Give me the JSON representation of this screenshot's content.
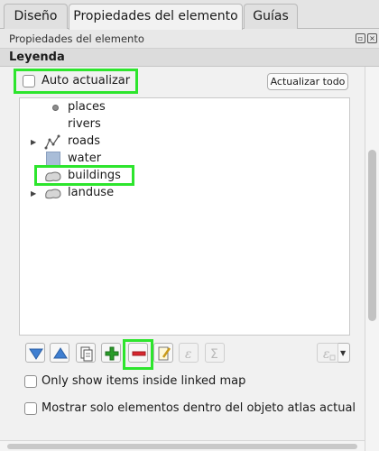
{
  "tabs": [
    {
      "label": "Diseño",
      "active": false
    },
    {
      "label": "Propiedades del elemento",
      "active": true
    },
    {
      "label": "Guías",
      "active": false
    }
  ],
  "panel": {
    "title": "Propiedades del elemento"
  },
  "section": {
    "title": "Leyenda"
  },
  "auto_update": {
    "label": "Auto actualizar",
    "checked": false
  },
  "refresh_all_label": "Actualizar todo",
  "tree": [
    {
      "label": "places",
      "symbol": "point-icon",
      "expandable": false
    },
    {
      "label": "rivers",
      "symbol": "none",
      "expandable": false
    },
    {
      "label": "roads",
      "symbol": "line-icon",
      "expandable": true
    },
    {
      "label": "water",
      "symbol": "polygon-fill-icon",
      "color": "#a9bdd8",
      "expandable": false
    },
    {
      "label": "buildings",
      "symbol": "polygon-outline-icon",
      "expandable": false
    },
    {
      "label": "landuse",
      "symbol": "polygon-outline-icon",
      "expandable": true
    }
  ],
  "toolbar": [
    {
      "name": "move-down-icon",
      "enabled": true
    },
    {
      "name": "move-up-icon",
      "enabled": true
    },
    {
      "name": "add-group-icon",
      "enabled": true
    },
    {
      "name": "add-item-icon",
      "enabled": true
    },
    {
      "name": "remove-item-icon",
      "enabled": true
    },
    {
      "name": "edit-item-icon",
      "enabled": true
    },
    {
      "name": "expression-icon",
      "enabled": false
    },
    {
      "name": "sum-icon",
      "enabled": false
    },
    {
      "name": "expression-filter-icon",
      "enabled": false
    }
  ],
  "only_linked_map": {
    "label": "Only show items inside linked map",
    "checked": false
  },
  "only_atlas": {
    "label": "Mostrar solo elementos dentro del objeto atlas actual",
    "checked": false
  },
  "colors": {
    "highlight": "#2de52d",
    "remove": "#d9262e",
    "add": "#2a9c2a",
    "arrow": "#3f7fd1"
  }
}
